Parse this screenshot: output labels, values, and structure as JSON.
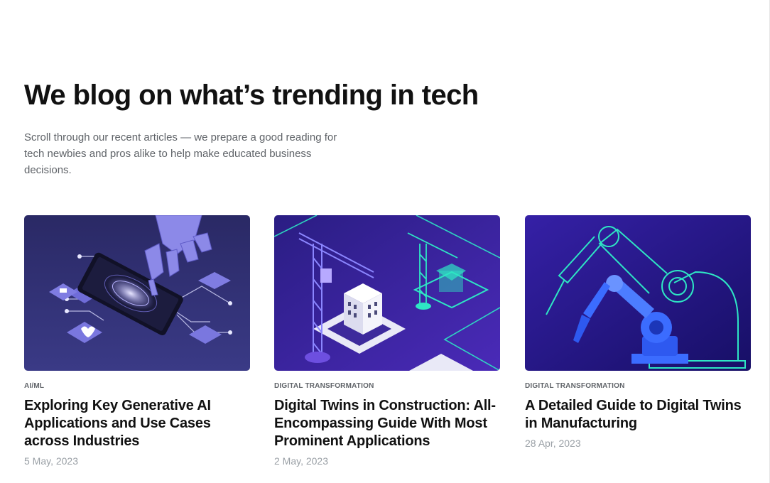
{
  "section": {
    "heading": "We blog on what’s trending in tech",
    "intro": "Scroll through our recent articles — we prepare a good reading for tech newbies and pros alike to help make educated business decisions."
  },
  "articles": [
    {
      "category": "AI/ML",
      "title": "Exploring Key Generative AI Applications and Use Cases across Industries",
      "date": "5 May, 2023",
      "illustration": "robot-hand-touching-smartphone-icon"
    },
    {
      "category": "DIGITAL TRANSFORMATION",
      "title": "Digital Twins in Construction: All-Encompassing Guide With Most Prominent Applications",
      "date": "2 May, 2023",
      "illustration": "isometric-construction-cranes-icon"
    },
    {
      "category": "DIGITAL TRANSFORMATION",
      "title": "A Detailed Guide to Digital Twins in Manufacturing",
      "date": "28 Apr, 2023",
      "illustration": "industrial-robot-arms-icon"
    }
  ],
  "colors": {
    "heading": "#111111",
    "body_text": "#5f6368",
    "date": "#9aa0a6",
    "card_bg_1": "#2b2a6b",
    "card_bg_2": "#3a2396",
    "card_bg_3": "#2a1a8c",
    "accent_teal": "#2ee6c4",
    "accent_violet": "#8b86ff"
  }
}
